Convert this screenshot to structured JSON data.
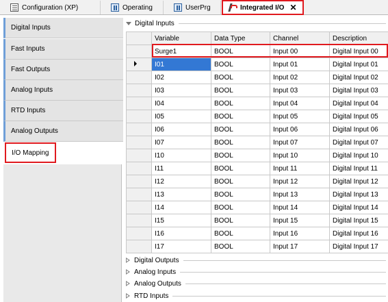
{
  "tabs": [
    {
      "label": "Configuration (XP)",
      "icon": "config-icon"
    },
    {
      "label": "Operating",
      "icon": "program-icon"
    },
    {
      "label": "UserPrg",
      "icon": "program-icon"
    },
    {
      "label": "Integrated I/O",
      "icon": "io-icon",
      "active": true,
      "close": "✕"
    }
  ],
  "nav": {
    "items": [
      "Digital Inputs",
      "Fast Inputs",
      "Fast Outputs",
      "Analog Inputs",
      "RTD Inputs",
      "Analog Outputs",
      "I/O Mapping"
    ],
    "selected": "I/O Mapping"
  },
  "sections": {
    "digital_inputs": "Digital Inputs",
    "collapsed": [
      "Digital Outputs",
      "Analog Inputs",
      "Analog Outputs",
      "RTD Inputs"
    ]
  },
  "table": {
    "columns": [
      "Variable",
      "Data Type",
      "Channel",
      "Description"
    ],
    "rows": [
      [
        "Surge1",
        "BOOL",
        "Input 00",
        "Digital Input 00"
      ],
      [
        "I01",
        "BOOL",
        "Input 01",
        "Digital Input 01"
      ],
      [
        "I02",
        "BOOL",
        "Input 02",
        "Digital Input 02"
      ],
      [
        "I03",
        "BOOL",
        "Input 03",
        "Digital Input 03"
      ],
      [
        "I04",
        "BOOL",
        "Input 04",
        "Digital Input 04"
      ],
      [
        "I05",
        "BOOL",
        "Input 05",
        "Digital Input 05"
      ],
      [
        "I06",
        "BOOL",
        "Input 06",
        "Digital Input 06"
      ],
      [
        "I07",
        "BOOL",
        "Input 07",
        "Digital Input 07"
      ],
      [
        "I10",
        "BOOL",
        "Input 10",
        "Digital Input 10"
      ],
      [
        "I11",
        "BOOL",
        "Input 11",
        "Digital Input 11"
      ],
      [
        "I12",
        "BOOL",
        "Input 12",
        "Digital Input 12"
      ],
      [
        "I13",
        "BOOL",
        "Input 13",
        "Digital Input 13"
      ],
      [
        "I14",
        "BOOL",
        "Input 14",
        "Digital Input 14"
      ],
      [
        "I15",
        "BOOL",
        "Input 15",
        "Digital Input 15"
      ],
      [
        "I16",
        "BOOL",
        "Input 16",
        "Digital Input 16"
      ],
      [
        "I17",
        "BOOL",
        "Input 17",
        "Digital Input 17"
      ]
    ],
    "selected_row": 1
  },
  "colors": {
    "highlight": "#e0191e",
    "selection": "#3378d4",
    "nav_accent": "#6f9fd8"
  }
}
